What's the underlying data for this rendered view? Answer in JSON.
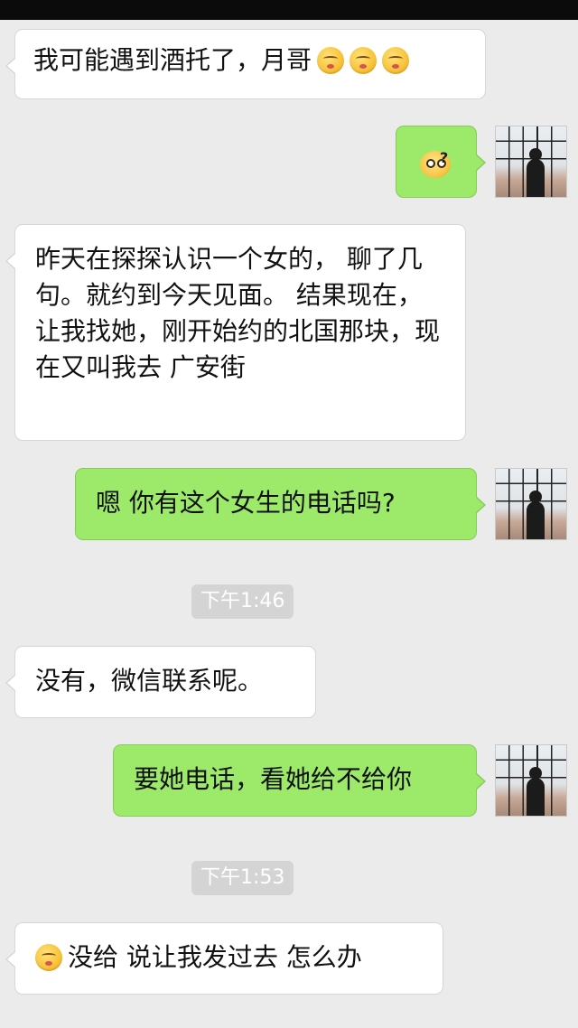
{
  "messages": [
    {
      "side": "in",
      "text": "我可能遇到酒托了，月哥"
    },
    {
      "side": "out",
      "sticker": "confused-face-sticker"
    },
    {
      "side": "in",
      "text": "昨天在探探认识一个女的， 聊了几句。就约到今天见面。 结果现在，让我找她，刚开始约的北国那块，现在又叫我去 广安街"
    },
    {
      "side": "out",
      "text": "嗯 你有这个女生的电话吗?"
    },
    {
      "type": "time",
      "text": "下午1:46"
    },
    {
      "side": "in",
      "text": "没有，微信联系呢。"
    },
    {
      "side": "out",
      "text": "要她电话，看她给不给你"
    },
    {
      "type": "time",
      "text": "下午1:53"
    },
    {
      "side": "in",
      "text": "没给 说让我发过去  怎么办"
    }
  ],
  "colors": {
    "background": "#ebebeb",
    "incoming_bubble": "#ffffff",
    "outgoing_bubble": "#9dea6a",
    "timestamp_bg": "#d4d4d4"
  }
}
